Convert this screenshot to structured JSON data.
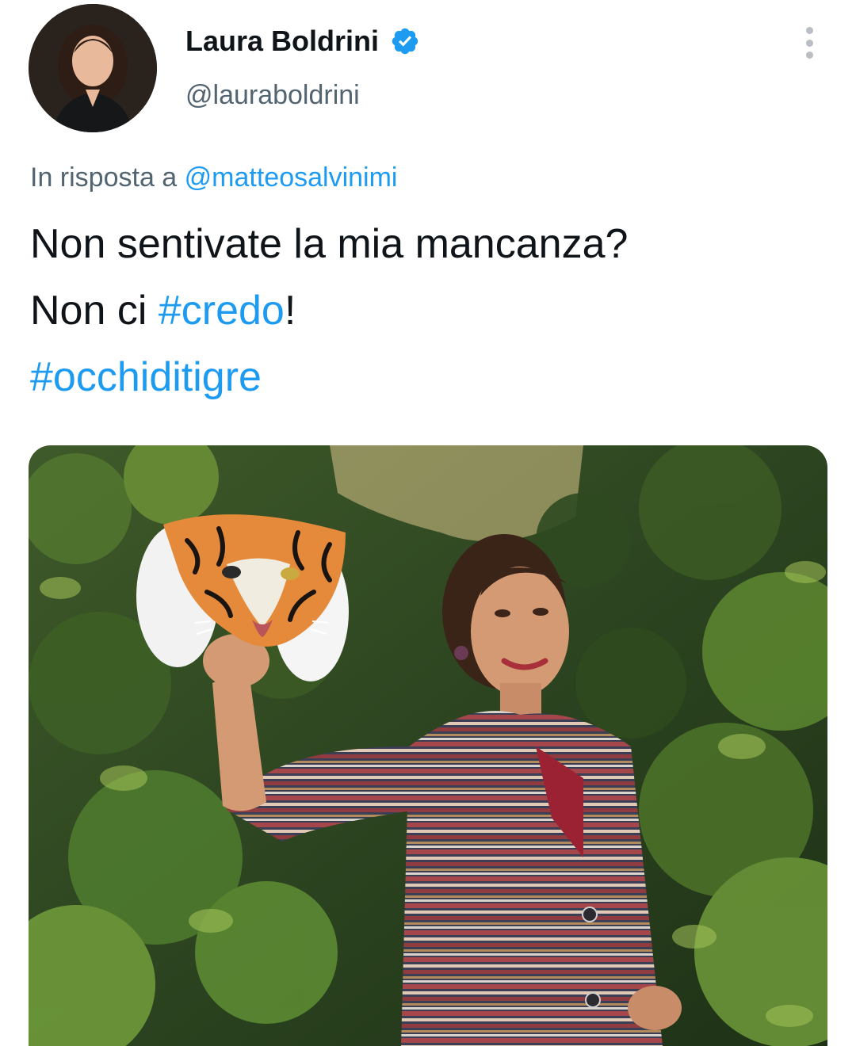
{
  "author": {
    "display_name": "Laura Boldrini",
    "handle": "@lauraboldrini",
    "avatar_icon": "profile-photo",
    "verified_icon": "verified-badge-icon",
    "verified_color": "#1d9bf0"
  },
  "menu": {
    "icon": "more-vertical-icon"
  },
  "reply": {
    "prefix": "In risposta a",
    "mention": "@matteosalvinimi"
  },
  "body": {
    "line1": "Non sentivate la mia mancanza?",
    "line2_prefix": "Non ci ",
    "hashtag1": "#credo",
    "line2_suffix": "!",
    "hashtag2": "#occhiditigre"
  },
  "media": {
    "type": "photo"
  },
  "colors": {
    "text": "#0f1419",
    "secondary": "#536471",
    "link": "#1d9bf0"
  }
}
